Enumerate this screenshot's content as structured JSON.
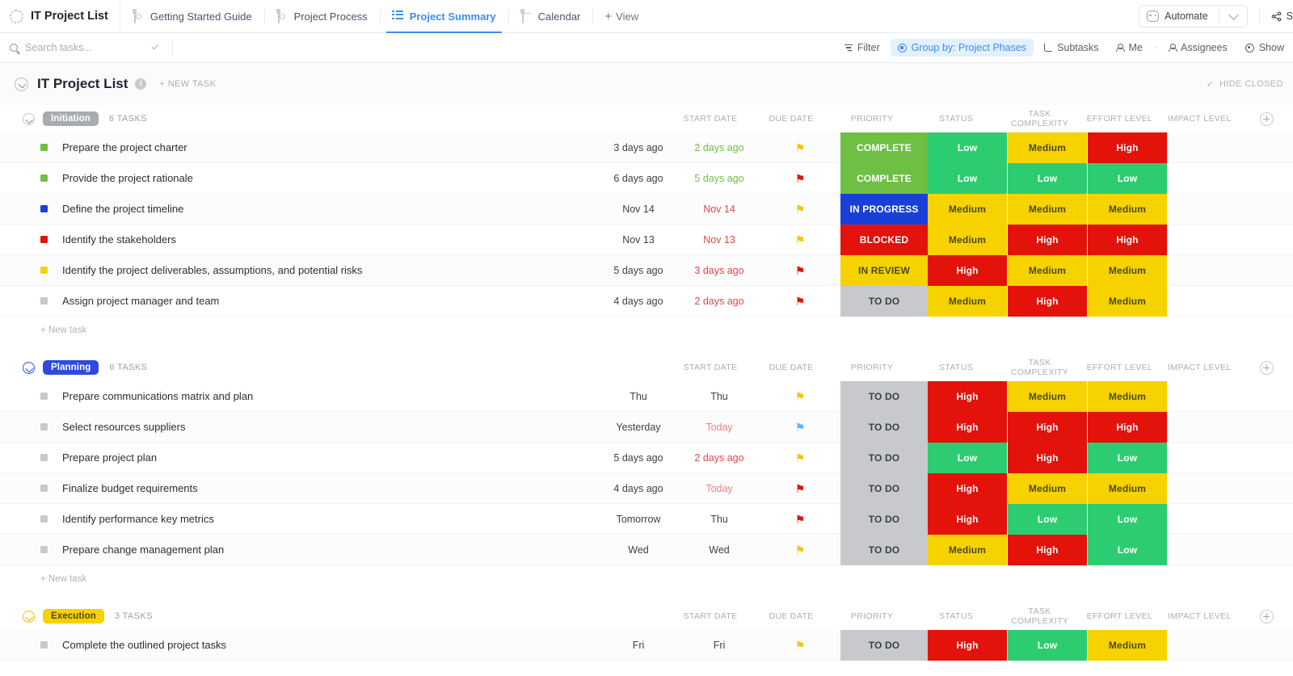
{
  "window": {
    "app_title": "IT Project List",
    "tabs": [
      {
        "label": "Getting Started Guide",
        "icon": "doc-icon",
        "active": false
      },
      {
        "label": "Project Process",
        "icon": "doc-icon",
        "active": false
      },
      {
        "label": "Project Summary",
        "icon": "list-icon",
        "active": true
      },
      {
        "label": "Calendar",
        "icon": "calendar-icon",
        "active": false
      }
    ],
    "add_view_label": "View",
    "automate_label": "Automate",
    "share_label": "S"
  },
  "search": {
    "placeholder": "Search tasks...",
    "value": ""
  },
  "toolbar": {
    "filter_label": "Filter",
    "group_by_label": "Group by: Project Phases",
    "subtasks_label": "Subtasks",
    "me_label": "Me",
    "separator": "·",
    "assignees_label": "Assignees",
    "show_label": "Show"
  },
  "page": {
    "title": "IT Project List",
    "info_glyph": "i",
    "new_task_label": "+ NEW TASK",
    "hide_closed_label": "HIDE CLOSED",
    "check_glyph": "✓"
  },
  "columns": [
    "START DATE",
    "DUE DATE",
    "PRIORITY",
    "STATUS",
    "TASK COMPLEXITY",
    "EFFORT LEVEL",
    "IMPACT LEVEL"
  ],
  "colors": {
    "accent_blue": "#3d8df5",
    "status_complete": "#6fbf44",
    "status_in_progress": "#1a3fd8",
    "status_blocked": "#e3120b",
    "status_in_review": "#f5d200",
    "status_todo": "#c7c9cc",
    "level_low": "#2ecc71",
    "level_medium": "#f5d200",
    "level_high": "#e3120b",
    "badge_initiation": "#a8abb1",
    "badge_planning": "#2f4ae0",
    "badge_execution": "#f5d200",
    "due_overdue": "#e0484a",
    "due_done": "#6fbf44",
    "flag_yellow": "#f5c400",
    "flag_red": "#e3120b",
    "flag_blue": "#5bb9f0"
  },
  "new_task_inline_label": "+ New task",
  "groups": [
    {
      "name": "Initiation",
      "badge_color": "#a8abb1",
      "badge_text_color": "#ffffff",
      "chev_class": "gray",
      "count_label": "6 TASKS",
      "show_new_task": true,
      "tasks": [
        {
          "name": "Prepare the project charter",
          "dot": "#6fbf44",
          "start": "3 days ago",
          "due": "2 days ago",
          "due_color": "#6fbf44",
          "priority": "flag-yellow",
          "status": "COMPLETE",
          "status_bg": "#6fbf44",
          "status_fg": "#ffffff",
          "complexity": "Low",
          "complexity_bg": "#2ecc71",
          "complexity_fg": "#ffffff",
          "effort": "Medium",
          "effort_bg": "#f5d200",
          "effort_fg": "#4a4a20",
          "impact": "High",
          "impact_bg": "#e3120b",
          "impact_fg": "#ffffff"
        },
        {
          "name": "Provide the project rationale",
          "dot": "#6fbf44",
          "start": "6 days ago",
          "due": "5 days ago",
          "due_color": "#6fbf44",
          "priority": "flag-red",
          "status": "COMPLETE",
          "status_bg": "#6fbf44",
          "status_fg": "#ffffff",
          "complexity": "Low",
          "complexity_bg": "#2ecc71",
          "complexity_fg": "#ffffff",
          "effort": "Low",
          "effort_bg": "#2ecc71",
          "effort_fg": "#ffffff",
          "impact": "Low",
          "impact_bg": "#2ecc71",
          "impact_fg": "#ffffff"
        },
        {
          "name": "Define the project timeline",
          "dot": "#1a3fd8",
          "start": "Nov 14",
          "due": "Nov 14",
          "due_color": "#e0484a",
          "priority": "flag-yellow",
          "status": "IN PROGRESS",
          "status_bg": "#1a3fd8",
          "status_fg": "#ffffff",
          "complexity": "Medium",
          "complexity_bg": "#f5d200",
          "complexity_fg": "#4a4a20",
          "effort": "Medium",
          "effort_bg": "#f5d200",
          "effort_fg": "#4a4a20",
          "impact": "Medium",
          "impact_bg": "#f5d200",
          "impact_fg": "#4a4a20"
        },
        {
          "name": "Identify the stakeholders",
          "dot": "#e3120b",
          "start": "Nov 13",
          "due": "Nov 13",
          "due_color": "#e0484a",
          "priority": "flag-yellow",
          "status": "BLOCKED",
          "status_bg": "#e3120b",
          "status_fg": "#ffffff",
          "complexity": "Medium",
          "complexity_bg": "#f5d200",
          "complexity_fg": "#4a4a20",
          "effort": "High",
          "effort_bg": "#e3120b",
          "effort_fg": "#ffffff",
          "impact": "High",
          "impact_bg": "#e3120b",
          "impact_fg": "#ffffff"
        },
        {
          "name": "Identify the project deliverables, assumptions, and potential risks",
          "dot": "#f5d200",
          "start": "5 days ago",
          "due": "3 days ago",
          "due_color": "#e0484a",
          "priority": "flag-red",
          "status": "IN REVIEW",
          "status_bg": "#f5d200",
          "status_fg": "#4a4a20",
          "complexity": "High",
          "complexity_bg": "#e3120b",
          "complexity_fg": "#ffffff",
          "effort": "Medium",
          "effort_bg": "#f5d200",
          "effort_fg": "#4a4a20",
          "impact": "Medium",
          "impact_bg": "#f5d200",
          "impact_fg": "#4a4a20"
        },
        {
          "name": "Assign project manager and team",
          "dot": "#c7c9cc",
          "start": "4 days ago",
          "due": "2 days ago",
          "due_color": "#e0484a",
          "priority": "flag-red",
          "status": "TO DO",
          "status_bg": "#c7c9cc",
          "status_fg": "#3c4148",
          "complexity": "Medium",
          "complexity_bg": "#f5d200",
          "complexity_fg": "#4a4a20",
          "effort": "High",
          "effort_bg": "#e3120b",
          "effort_fg": "#ffffff",
          "impact": "Medium",
          "impact_bg": "#f5d200",
          "impact_fg": "#4a4a20"
        }
      ]
    },
    {
      "name": "Planning",
      "badge_color": "#2f4ae0",
      "badge_text_color": "#ffffff",
      "chev_class": "blue",
      "count_label": "6 TASKS",
      "show_new_task": true,
      "tasks": [
        {
          "name": "Prepare communications matrix and plan",
          "dot": "#c7c9cc",
          "start": "Thu",
          "due": "Thu",
          "due_color": "#3c4148",
          "priority": "flag-yellow",
          "status": "TO DO",
          "status_bg": "#c7c9cc",
          "status_fg": "#3c4148",
          "complexity": "High",
          "complexity_bg": "#e3120b",
          "complexity_fg": "#ffffff",
          "effort": "Medium",
          "effort_bg": "#f5d200",
          "effort_fg": "#4a4a20",
          "impact": "Medium",
          "impact_bg": "#f5d200",
          "impact_fg": "#4a4a20"
        },
        {
          "name": "Select resources suppliers",
          "dot": "#c7c9cc",
          "start": "Yesterday",
          "due": "Today",
          "due_color": "#f08080",
          "priority": "flag-blue",
          "status": "TO DO",
          "status_bg": "#c7c9cc",
          "status_fg": "#3c4148",
          "complexity": "High",
          "complexity_bg": "#e3120b",
          "complexity_fg": "#ffffff",
          "effort": "High",
          "effort_bg": "#e3120b",
          "effort_fg": "#ffffff",
          "impact": "High",
          "impact_bg": "#e3120b",
          "impact_fg": "#ffffff"
        },
        {
          "name": "Prepare project plan",
          "dot": "#c7c9cc",
          "start": "5 days ago",
          "due": "2 days ago",
          "due_color": "#e0484a",
          "priority": "flag-yellow",
          "status": "TO DO",
          "status_bg": "#c7c9cc",
          "status_fg": "#3c4148",
          "complexity": "Low",
          "complexity_bg": "#2ecc71",
          "complexity_fg": "#ffffff",
          "effort": "High",
          "effort_bg": "#e3120b",
          "effort_fg": "#ffffff",
          "impact": "Low",
          "impact_bg": "#2ecc71",
          "impact_fg": "#ffffff"
        },
        {
          "name": "Finalize budget requirements",
          "dot": "#c7c9cc",
          "start": "4 days ago",
          "due": "Today",
          "due_color": "#f08080",
          "priority": "flag-red",
          "status": "TO DO",
          "status_bg": "#c7c9cc",
          "status_fg": "#3c4148",
          "complexity": "High",
          "complexity_bg": "#e3120b",
          "complexity_fg": "#ffffff",
          "effort": "Medium",
          "effort_bg": "#f5d200",
          "effort_fg": "#4a4a20",
          "impact": "Medium",
          "impact_bg": "#f5d200",
          "impact_fg": "#4a4a20"
        },
        {
          "name": "Identify performance key metrics",
          "dot": "#c7c9cc",
          "start": "Tomorrow",
          "due": "Thu",
          "due_color": "#3c4148",
          "priority": "flag-red",
          "status": "TO DO",
          "status_bg": "#c7c9cc",
          "status_fg": "#3c4148",
          "complexity": "High",
          "complexity_bg": "#e3120b",
          "complexity_fg": "#ffffff",
          "effort": "Low",
          "effort_bg": "#2ecc71",
          "effort_fg": "#ffffff",
          "impact": "Low",
          "impact_bg": "#2ecc71",
          "impact_fg": "#ffffff"
        },
        {
          "name": "Prepare change management plan",
          "dot": "#c7c9cc",
          "start": "Wed",
          "due": "Wed",
          "due_color": "#3c4148",
          "priority": "flag-yellow",
          "status": "TO DO",
          "status_bg": "#c7c9cc",
          "status_fg": "#3c4148",
          "complexity": "Medium",
          "complexity_bg": "#f5d200",
          "complexity_fg": "#4a4a20",
          "effort": "High",
          "effort_bg": "#e3120b",
          "effort_fg": "#ffffff",
          "impact": "Low",
          "impact_bg": "#2ecc71",
          "impact_fg": "#ffffff"
        }
      ]
    },
    {
      "name": "Execution",
      "badge_color": "#f5d200",
      "badge_text_color": "#4a4a20",
      "chev_class": "yellow",
      "count_label": "3 TASKS",
      "show_new_task": false,
      "tasks": [
        {
          "name": "Complete the outlined project tasks",
          "dot": "#c7c9cc",
          "start": "Fri",
          "due": "Fri",
          "due_color": "#3c4148",
          "priority": "flag-yellow",
          "status": "TO DO",
          "status_bg": "#c7c9cc",
          "status_fg": "#3c4148",
          "complexity": "High",
          "complexity_bg": "#e3120b",
          "complexity_fg": "#ffffff",
          "effort": "Low",
          "effort_bg": "#2ecc71",
          "effort_fg": "#ffffff",
          "impact": "Medium",
          "impact_bg": "#f5d200",
          "impact_fg": "#4a4a20"
        }
      ]
    }
  ]
}
